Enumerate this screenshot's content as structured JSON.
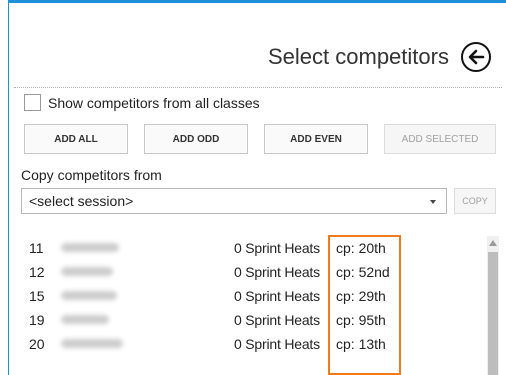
{
  "header": {
    "title": "Select competitors",
    "back_icon": "arrow-left-icon"
  },
  "filter": {
    "checkbox_label": "Show competitors from all classes",
    "checked": false
  },
  "actions": {
    "add_all": "ADD ALL",
    "add_odd": "ADD ODD",
    "add_even": "ADD EVEN",
    "add_selected": "ADD SELECTED"
  },
  "copy": {
    "label": "Copy competitors from",
    "session_value": "<select session>",
    "button": "COPY"
  },
  "competitors": [
    {
      "number": "11",
      "info": "0 Sprint Heats",
      "cp": "cp: 20th"
    },
    {
      "number": "12",
      "info": "0 Sprint Heats",
      "cp": "cp: 52nd"
    },
    {
      "number": "15",
      "info": "0 Sprint Heats",
      "cp": "cp: 29th"
    },
    {
      "number": "19",
      "info": "0 Sprint Heats",
      "cp": "cp: 95th"
    },
    {
      "number": "20",
      "info": "0 Sprint Heats",
      "cp": "cp: 13th"
    }
  ],
  "colors": {
    "accent_border": "#1e90d8",
    "highlight": "#f07b1e"
  }
}
